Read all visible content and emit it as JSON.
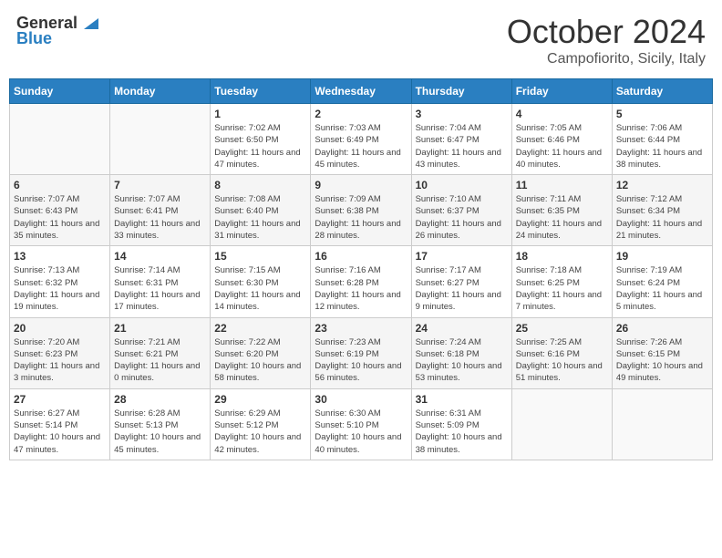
{
  "header": {
    "logo_general": "General",
    "logo_blue": "Blue",
    "title": "October 2024",
    "subtitle": "Campofiorito, Sicily, Italy"
  },
  "days_of_week": [
    "Sunday",
    "Monday",
    "Tuesday",
    "Wednesday",
    "Thursday",
    "Friday",
    "Saturday"
  ],
  "weeks": [
    [
      {
        "day": "",
        "info": ""
      },
      {
        "day": "",
        "info": ""
      },
      {
        "day": "1",
        "info": "Sunrise: 7:02 AM\nSunset: 6:50 PM\nDaylight: 11 hours and 47 minutes."
      },
      {
        "day": "2",
        "info": "Sunrise: 7:03 AM\nSunset: 6:49 PM\nDaylight: 11 hours and 45 minutes."
      },
      {
        "day": "3",
        "info": "Sunrise: 7:04 AM\nSunset: 6:47 PM\nDaylight: 11 hours and 43 minutes."
      },
      {
        "day": "4",
        "info": "Sunrise: 7:05 AM\nSunset: 6:46 PM\nDaylight: 11 hours and 40 minutes."
      },
      {
        "day": "5",
        "info": "Sunrise: 7:06 AM\nSunset: 6:44 PM\nDaylight: 11 hours and 38 minutes."
      }
    ],
    [
      {
        "day": "6",
        "info": "Sunrise: 7:07 AM\nSunset: 6:43 PM\nDaylight: 11 hours and 35 minutes."
      },
      {
        "day": "7",
        "info": "Sunrise: 7:07 AM\nSunset: 6:41 PM\nDaylight: 11 hours and 33 minutes."
      },
      {
        "day": "8",
        "info": "Sunrise: 7:08 AM\nSunset: 6:40 PM\nDaylight: 11 hours and 31 minutes."
      },
      {
        "day": "9",
        "info": "Sunrise: 7:09 AM\nSunset: 6:38 PM\nDaylight: 11 hours and 28 minutes."
      },
      {
        "day": "10",
        "info": "Sunrise: 7:10 AM\nSunset: 6:37 PM\nDaylight: 11 hours and 26 minutes."
      },
      {
        "day": "11",
        "info": "Sunrise: 7:11 AM\nSunset: 6:35 PM\nDaylight: 11 hours and 24 minutes."
      },
      {
        "day": "12",
        "info": "Sunrise: 7:12 AM\nSunset: 6:34 PM\nDaylight: 11 hours and 21 minutes."
      }
    ],
    [
      {
        "day": "13",
        "info": "Sunrise: 7:13 AM\nSunset: 6:32 PM\nDaylight: 11 hours and 19 minutes."
      },
      {
        "day": "14",
        "info": "Sunrise: 7:14 AM\nSunset: 6:31 PM\nDaylight: 11 hours and 17 minutes."
      },
      {
        "day": "15",
        "info": "Sunrise: 7:15 AM\nSunset: 6:30 PM\nDaylight: 11 hours and 14 minutes."
      },
      {
        "day": "16",
        "info": "Sunrise: 7:16 AM\nSunset: 6:28 PM\nDaylight: 11 hours and 12 minutes."
      },
      {
        "day": "17",
        "info": "Sunrise: 7:17 AM\nSunset: 6:27 PM\nDaylight: 11 hours and 9 minutes."
      },
      {
        "day": "18",
        "info": "Sunrise: 7:18 AM\nSunset: 6:25 PM\nDaylight: 11 hours and 7 minutes."
      },
      {
        "day": "19",
        "info": "Sunrise: 7:19 AM\nSunset: 6:24 PM\nDaylight: 11 hours and 5 minutes."
      }
    ],
    [
      {
        "day": "20",
        "info": "Sunrise: 7:20 AM\nSunset: 6:23 PM\nDaylight: 11 hours and 3 minutes."
      },
      {
        "day": "21",
        "info": "Sunrise: 7:21 AM\nSunset: 6:21 PM\nDaylight: 11 hours and 0 minutes."
      },
      {
        "day": "22",
        "info": "Sunrise: 7:22 AM\nSunset: 6:20 PM\nDaylight: 10 hours and 58 minutes."
      },
      {
        "day": "23",
        "info": "Sunrise: 7:23 AM\nSunset: 6:19 PM\nDaylight: 10 hours and 56 minutes."
      },
      {
        "day": "24",
        "info": "Sunrise: 7:24 AM\nSunset: 6:18 PM\nDaylight: 10 hours and 53 minutes."
      },
      {
        "day": "25",
        "info": "Sunrise: 7:25 AM\nSunset: 6:16 PM\nDaylight: 10 hours and 51 minutes."
      },
      {
        "day": "26",
        "info": "Sunrise: 7:26 AM\nSunset: 6:15 PM\nDaylight: 10 hours and 49 minutes."
      }
    ],
    [
      {
        "day": "27",
        "info": "Sunrise: 6:27 AM\nSunset: 5:14 PM\nDaylight: 10 hours and 47 minutes."
      },
      {
        "day": "28",
        "info": "Sunrise: 6:28 AM\nSunset: 5:13 PM\nDaylight: 10 hours and 45 minutes."
      },
      {
        "day": "29",
        "info": "Sunrise: 6:29 AM\nSunset: 5:12 PM\nDaylight: 10 hours and 42 minutes."
      },
      {
        "day": "30",
        "info": "Sunrise: 6:30 AM\nSunset: 5:10 PM\nDaylight: 10 hours and 40 minutes."
      },
      {
        "day": "31",
        "info": "Sunrise: 6:31 AM\nSunset: 5:09 PM\nDaylight: 10 hours and 38 minutes."
      },
      {
        "day": "",
        "info": ""
      },
      {
        "day": "",
        "info": ""
      }
    ]
  ]
}
